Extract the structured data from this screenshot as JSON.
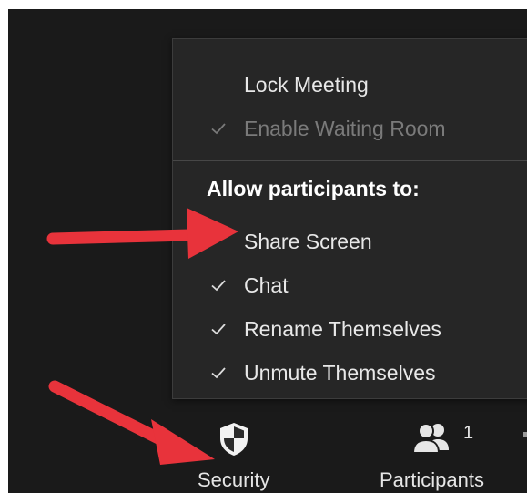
{
  "security_menu": {
    "items": [
      {
        "label": "Lock Meeting",
        "checked": false,
        "enabled": true
      },
      {
        "label": "Enable Waiting Room",
        "checked": true,
        "enabled": false
      }
    ],
    "section_heading": "Allow participants to:",
    "participant_permissions": [
      {
        "label": "Share Screen",
        "checked": false
      },
      {
        "label": "Chat",
        "checked": true
      },
      {
        "label": "Rename Themselves",
        "checked": true
      },
      {
        "label": "Unmute Themselves",
        "checked": true
      }
    ]
  },
  "toolbar": {
    "security": {
      "label": "Security",
      "icon": "shield-icon"
    },
    "participants": {
      "label": "Participants",
      "icon": "participants-icon",
      "count": "1"
    }
  },
  "annotations": {
    "arrow_color": "#e8333b"
  }
}
